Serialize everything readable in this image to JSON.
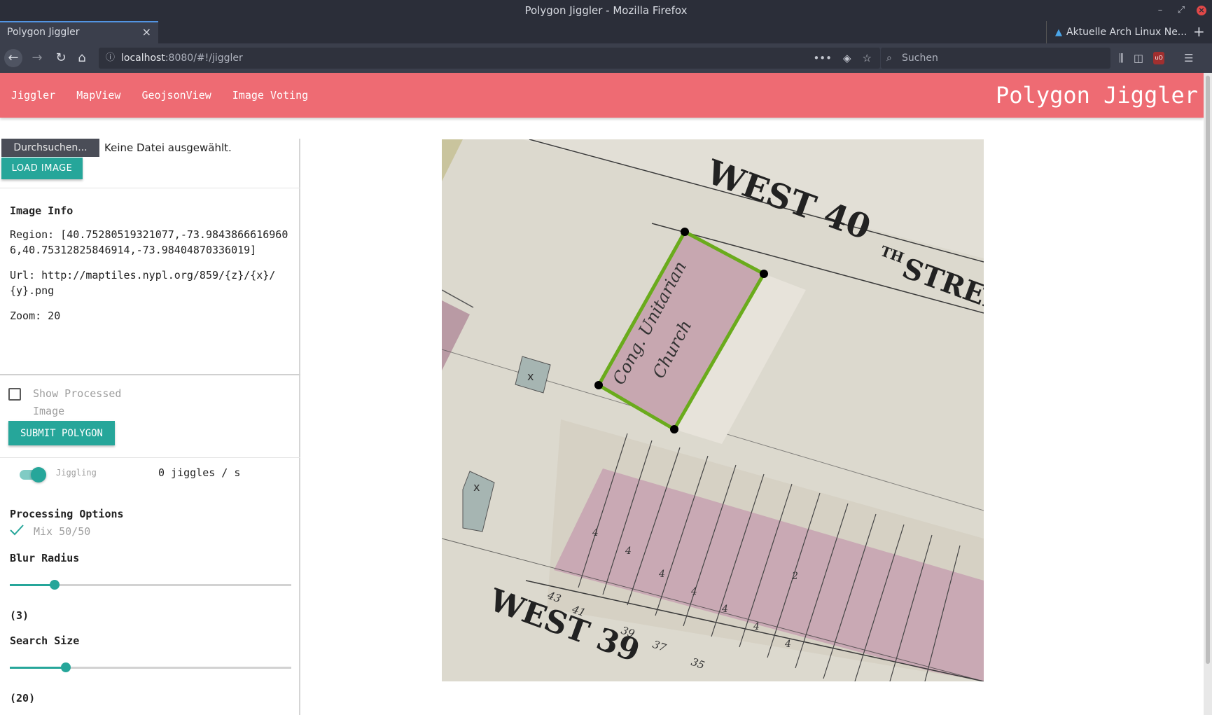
{
  "window": {
    "title": "Polygon Jiggler - Mozilla Firefox"
  },
  "browser": {
    "active_tab": "Polygon Jiggler",
    "other_tab": "Aktuelle Arch Linux Ne...",
    "url_host": "localhost",
    "url_rest": ":8080/#!/jiggler",
    "search_placeholder": "Suchen"
  },
  "app": {
    "brand": "Polygon Jiggler",
    "nav": [
      "Jiggler",
      "MapView",
      "GeojsonView",
      "Image Voting"
    ]
  },
  "file": {
    "browse_label": "Durchsuchen...",
    "status": "Keine Datei ausgewählt.",
    "load_label": "LOAD IMAGE"
  },
  "image_info": {
    "title": "Image Info",
    "region": "Region: [40.75280519321077,-73.98438666169606,40.75312825846914,-73.98404870336019]",
    "url": "Url: http://maptiles.nypl.org/859/{z}/{x}/{y}.png",
    "zoom": "Zoom: 20"
  },
  "controls": {
    "show_processed_label": "Show Processed Image",
    "show_processed_checked": false,
    "submit_label": "SUBMIT POLYGON",
    "jiggling_label": "Jiggling",
    "jiggling_on": true,
    "jiggle_rate": "0 jiggles / s"
  },
  "processing": {
    "title": "Processing Options",
    "mix_label": "Mix 50/50",
    "mix_checked": true,
    "blur_title": "Blur Radius",
    "blur_value": "(3)",
    "blur_fraction": 0.16,
    "search_title": "Search Size",
    "search_value": "(20)",
    "search_fraction": 0.2
  },
  "map": {
    "street_top": "WEST 40",
    "street_top_suffix": "TH",
    "street_top_tail": "STREET",
    "street_bottom": "WEST 39",
    "church_line1": "Cong. Unitarian",
    "church_line2": "Church",
    "lot_numbers": [
      "43",
      "41",
      "39",
      "37",
      "35"
    ],
    "lot_marks": [
      "4",
      "4",
      "4",
      "4",
      "4",
      "4",
      "4",
      "2"
    ],
    "marker_x": "x",
    "polygon_color": "#6aab1c",
    "vertex_color": "#000000"
  },
  "colors": {
    "accent": "#26a69a",
    "header": "#ee6b73"
  }
}
